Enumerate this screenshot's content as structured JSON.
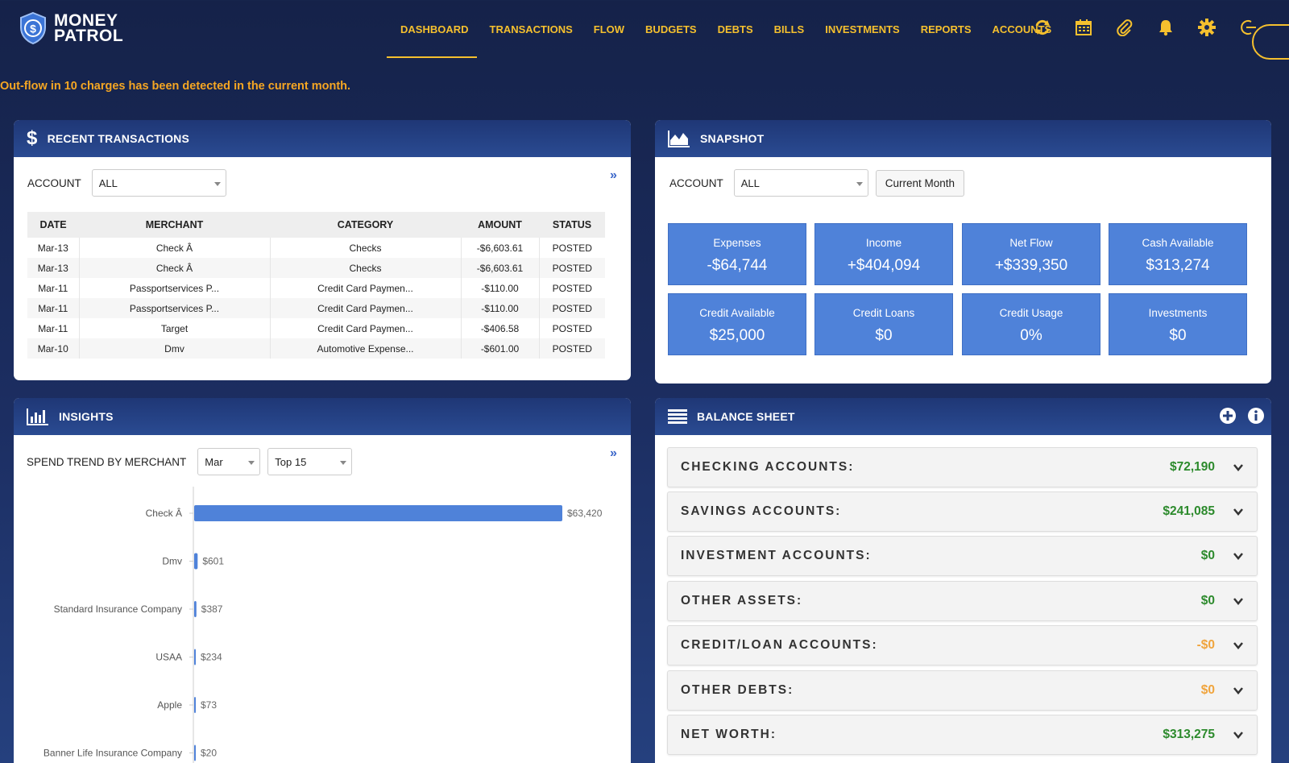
{
  "brand": {
    "line1": "MONEY",
    "line2": "PATROL"
  },
  "nav": {
    "items": [
      "DASHBOARD",
      "TRANSACTIONS",
      "FLOW",
      "BUDGETS",
      "DEBTS",
      "BILLS",
      "INVESTMENTS",
      "REPORTS",
      "ACCOUNTS"
    ],
    "icons": [
      "refresh-icon",
      "calendar-icon",
      "paperclip-icon",
      "bell-icon",
      "gear-icon",
      "logout-icon"
    ]
  },
  "alert": "Out-flow in 10 charges has been detected in the current month.",
  "recent": {
    "title": "RECENT TRANSACTIONS",
    "account_label": "ACCOUNT",
    "account_value": "ALL",
    "more": "»",
    "headers": [
      "DATE",
      "MERCHANT",
      "CATEGORY",
      "AMOUNT",
      "STATUS"
    ],
    "rows": [
      [
        "Mar-13",
        "Check Â",
        "Checks",
        "-$6,603.61",
        "POSTED"
      ],
      [
        "Mar-13",
        "Check Â",
        "Checks",
        "-$6,603.61",
        "POSTED"
      ],
      [
        "Mar-11",
        "Passportservices P...",
        "Credit Card Paymen...",
        "-$110.00",
        "POSTED"
      ],
      [
        "Mar-11",
        "Passportservices P...",
        "Credit Card Paymen...",
        "-$110.00",
        "POSTED"
      ],
      [
        "Mar-11",
        "Target",
        "Credit Card Paymen...",
        "-$406.58",
        "POSTED"
      ],
      [
        "Mar-10",
        "Dmv",
        "Automotive Expense...",
        "-$601.00",
        "POSTED"
      ]
    ]
  },
  "snapshot": {
    "title": "SNAPSHOT",
    "account_label": "ACCOUNT",
    "account_value": "ALL",
    "period": "Current Month",
    "tiles": [
      {
        "label": "Expenses",
        "value": "-$64,744"
      },
      {
        "label": "Income",
        "value": "+$404,094"
      },
      {
        "label": "Net Flow",
        "value": "+$339,350"
      },
      {
        "label": "Cash Available",
        "value": "$313,274"
      },
      {
        "label": "Credit Available",
        "value": "$25,000"
      },
      {
        "label": "Credit Loans",
        "value": "$0"
      },
      {
        "label": "Credit Usage",
        "value": "0%"
      },
      {
        "label": "Investments",
        "value": "$0"
      }
    ]
  },
  "insights": {
    "title": "INSIGHTS",
    "spend_label": "SPEND TREND BY MERCHANT",
    "month": "Mar",
    "top": "Top 15",
    "more": "»"
  },
  "chart_data": {
    "type": "bar",
    "orientation": "horizontal",
    "categories": [
      "Check Â",
      "Dmv",
      "Standard Insurance Company",
      "USAA",
      "Apple",
      "Banner Life Insurance Company"
    ],
    "values": [
      63420,
      601,
      387,
      234,
      73,
      20
    ],
    "value_labels": [
      "$63,420",
      "$601",
      "$387",
      "$234",
      "$73",
      "$20"
    ],
    "color": "#4f82d9"
  },
  "balance": {
    "title": "BALANCE SHEET",
    "rows": [
      {
        "label": "CHECKING ACCOUNTS:",
        "value": "$72,190",
        "color": "#2c8a2c"
      },
      {
        "label": "SAVINGS ACCOUNTS:",
        "value": "$241,085",
        "color": "#2c8a2c"
      },
      {
        "label": "INVESTMENT ACCOUNTS:",
        "value": "$0",
        "color": "#2c8a2c"
      },
      {
        "label": "OTHER ASSETS:",
        "value": "$0",
        "color": "#2c8a2c"
      },
      {
        "label": "CREDIT/LOAN ACCOUNTS:",
        "value": "-$0",
        "color": "#f0a43c"
      },
      {
        "label": "OTHER DEBTS:",
        "value": "$0",
        "color": "#f0a43c"
      },
      {
        "label": "NET WORTH:",
        "value": "$313,275",
        "color": "#2c8a2c"
      }
    ]
  }
}
